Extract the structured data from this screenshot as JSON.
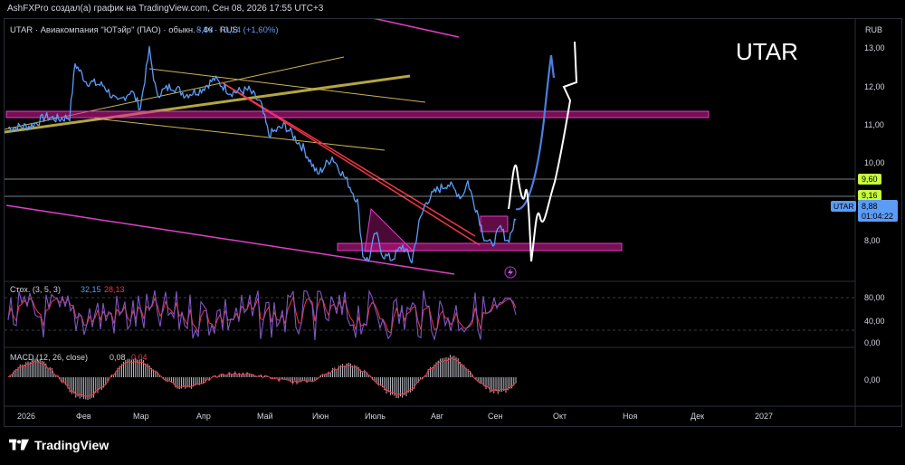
{
  "header": {
    "attribution": "AshFXPro создал(а) график на TradingView.com, Сен 08, 2026 17:55 UTC+3"
  },
  "legend": {
    "symbol": "UTAR · Авиакомпания \"ЮТэйр\" (ПАО) · обыкн. · 4ч · RUS",
    "price": "8,88",
    "change": "+0,14 (+1,60%)"
  },
  "watermark": "UTAR",
  "currency": "RUB",
  "price_axis": {
    "ticks": [
      "13,00",
      "12,00",
      "11,00",
      "10,00",
      "8,00"
    ],
    "level_labels": [
      {
        "text": "9,60",
        "color": "#c6ff3d"
      },
      {
        "text": "9,16",
        "color": "#c6ff3d"
      }
    ],
    "current": {
      "symbol": "UTAR",
      "price": "8,88",
      "countdown": "01:04:22",
      "color": "#5b9cf6"
    }
  },
  "stoch": {
    "title": "Стох. (3, 5, 3)",
    "k": "32,15",
    "d": "28,13",
    "k_color": "#5b9cf6",
    "d_color": "#f23645",
    "ticks": [
      "80,00",
      "40,00",
      "0,00"
    ]
  },
  "macd": {
    "title": "MACD (12, 26, close)",
    "v1": "0,08",
    "v2": "0,04",
    "tick": "0,00"
  },
  "time_axis": [
    "2026",
    "Фев",
    "Мар",
    "Апр",
    "Май",
    "Июн",
    "Июль",
    "Авг",
    "Сен",
    "Окт",
    "Ноя",
    "Дек",
    "2027"
  ],
  "footer": {
    "brand": "TradingView"
  },
  "colors": {
    "price_line": "#5b9cf6",
    "zone": "#d81b9a",
    "trend_red": "#f23645",
    "channel": "#e040c8",
    "wedge": "#c9b458"
  },
  "chart_data": {
    "type": "line",
    "ylim": [
      7.5,
      13.4
    ],
    "x": [
      "2026",
      "Фев",
      "Мар",
      "Апр",
      "Май",
      "Июн",
      "Июль",
      "Авг",
      "Сен"
    ],
    "series": [
      {
        "values": [
          10.95,
          12.1,
          11.6,
          11.8,
          11.55,
          9.75,
          7.95,
          9.7,
          8.88
        ]
      }
    ],
    "zones": [
      {
        "from": 11.25,
        "to": 11.4
      },
      {
        "from": 7.75,
        "to": 7.95
      }
    ],
    "levels": [
      9.6,
      9.16
    ],
    "last": 8.88
  }
}
